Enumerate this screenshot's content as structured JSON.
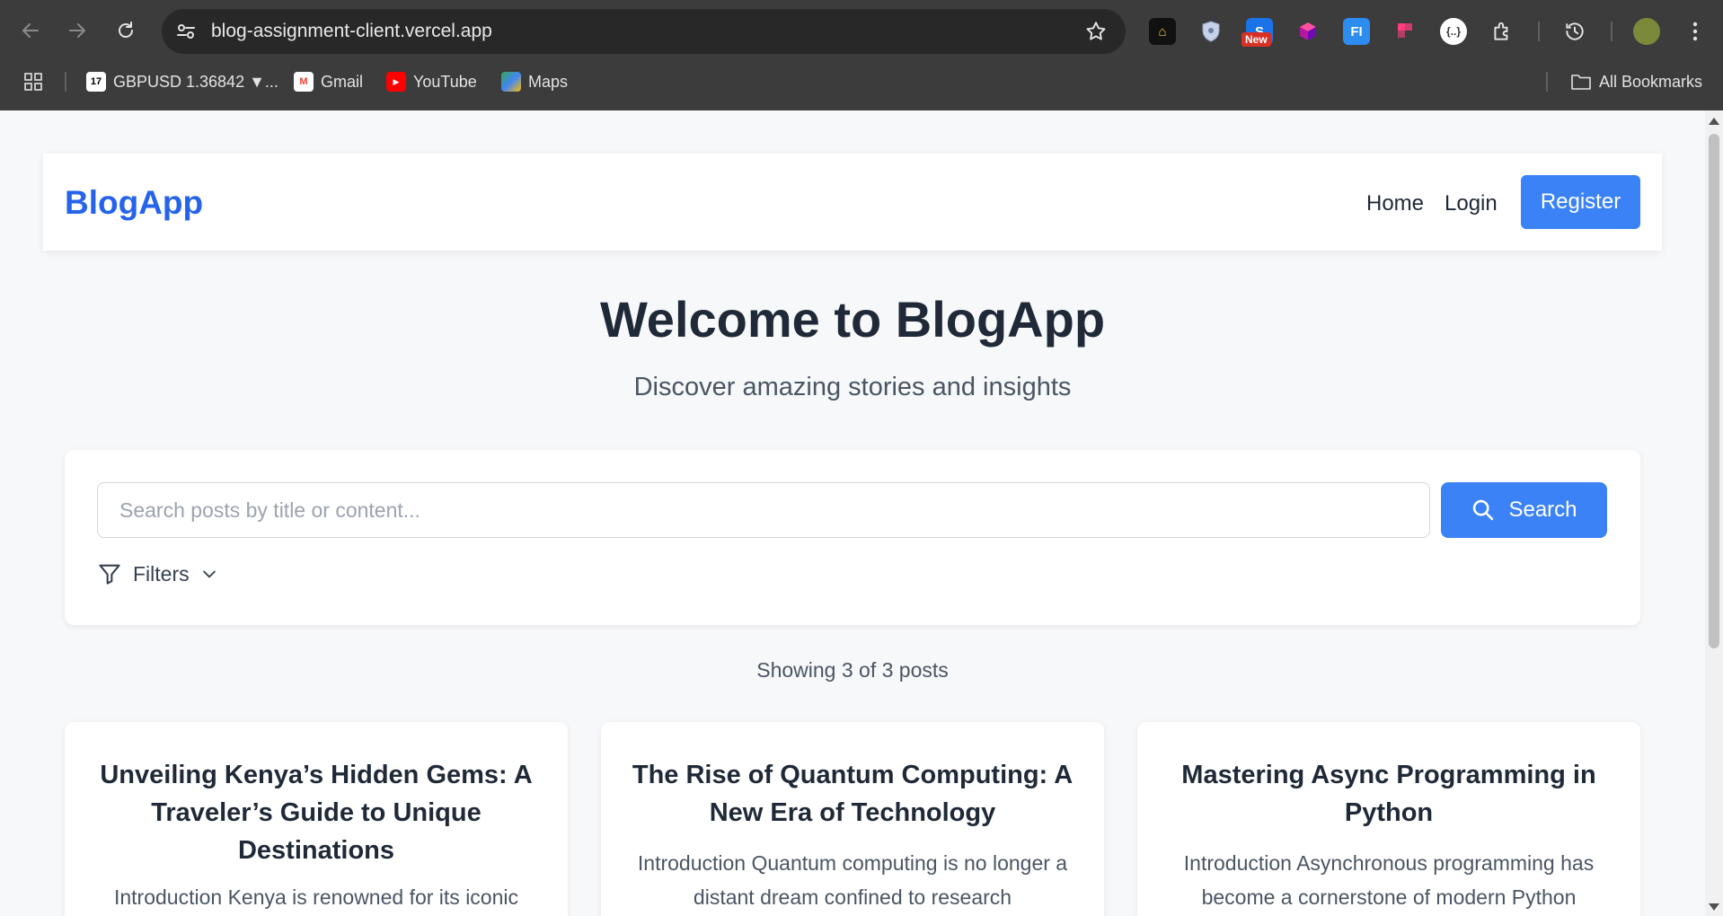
{
  "browser": {
    "url": "blog-assignment-client.vercel.app",
    "extension_new_badge": "New",
    "bookmarks": [
      {
        "label": "GBPUSD 1.36842 ▼...",
        "icon": "tradingview-icon"
      },
      {
        "label": "Gmail",
        "icon": "gmail-icon"
      },
      {
        "label": "YouTube",
        "icon": "youtube-icon"
      },
      {
        "label": "Maps",
        "icon": "maps-icon"
      }
    ],
    "all_bookmarks": "All Bookmarks"
  },
  "navbar": {
    "brand": "BlogApp",
    "links": [
      "Home",
      "Login"
    ],
    "register": "Register"
  },
  "hero": {
    "title": "Welcome to BlogApp",
    "subtitle": "Discover amazing stories and insights"
  },
  "search": {
    "placeholder": "Search posts by title or content...",
    "value": "",
    "button": "Search",
    "filters": "Filters"
  },
  "results": {
    "summary": "Showing 3 of 3 posts"
  },
  "posts": [
    {
      "title": "Unveiling Kenya’s Hidden Gems: A Traveler’s Guide to Unique Destinations",
      "excerpt": "Introduction Kenya is renowned for its iconic"
    },
    {
      "title": "The Rise of Quantum Computing: A New Era of Technology",
      "excerpt": "Introduction Quantum computing is no longer a distant dream confined to research"
    },
    {
      "title": "Mastering Async Programming in Python",
      "excerpt": "Introduction Asynchronous programming has become a cornerstone of modern Python"
    }
  ],
  "colors": {
    "accent": "#3b82f6",
    "brand": "#2563eb",
    "chrome": "#3c3c3c"
  }
}
